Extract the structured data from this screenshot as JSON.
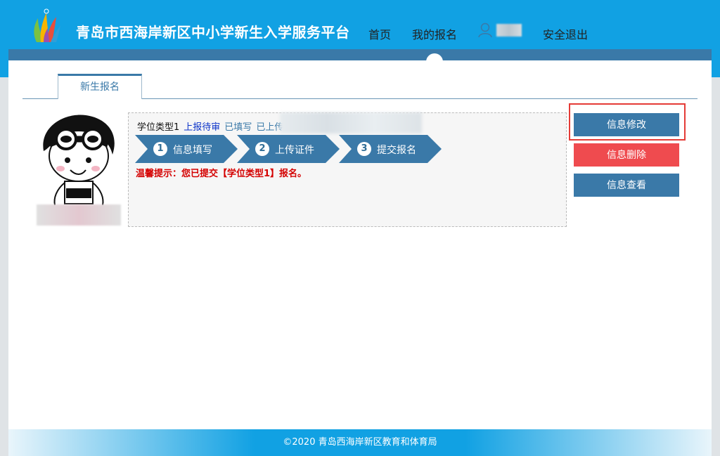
{
  "header": {
    "site_title": "青岛市西海岸新区中小学新生入学服务平台",
    "nav_home": "首页",
    "nav_my_registration": "我的报名",
    "nav_logout": "安全退出",
    "brand_color": "#11a1e3"
  },
  "tabs": [
    {
      "label": "新生报名",
      "active": true
    }
  ],
  "registration": {
    "type": "学位类型1",
    "status_pending": "上报待审",
    "status_filled": "已填写",
    "status_uploaded": "已上传",
    "steps": [
      {
        "num": "1",
        "label": "信息填写"
      },
      {
        "num": "2",
        "label": "上传证件"
      },
      {
        "num": "3",
        "label": "提交报名"
      }
    ],
    "tip": "温馨提示：您已提交【学位类型1】报名。"
  },
  "actions": {
    "edit": "信息修改",
    "delete": "信息删除",
    "view": "信息查看",
    "edit_color": "#3a79a8",
    "delete_color": "#ef4b4f"
  },
  "footer": {
    "copyright": "©2020 青岛西海岸新区教育和体育局"
  },
  "icons": {
    "logo": "colorful-flame-logo-icon",
    "user": "user-outline-icon",
    "avatar": "cartoon-kid-avatar"
  }
}
